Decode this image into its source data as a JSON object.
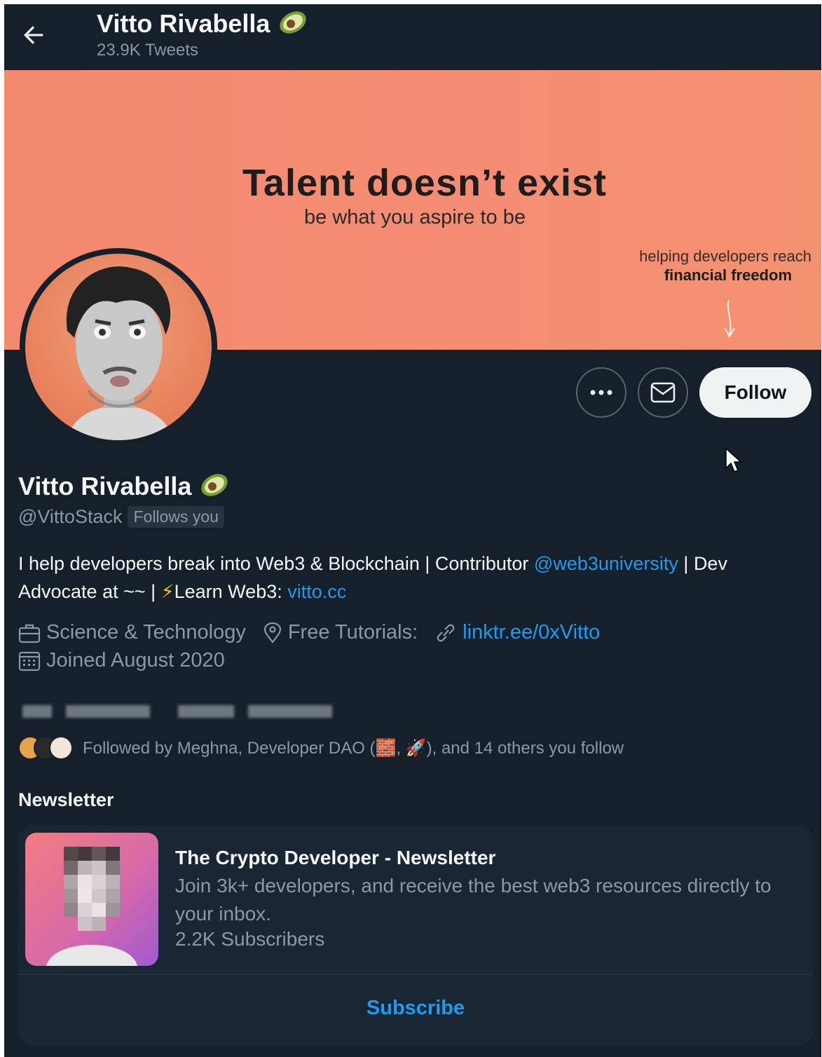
{
  "header": {
    "name": "Vitto Rivabella",
    "tweets": "23.9K Tweets"
  },
  "banner": {
    "title": "Talent doesn’t exist",
    "subtitle": "be what you aspire to be",
    "help_line1": "helping developers reach",
    "help_line2": "financial freedom"
  },
  "actions": {
    "follow_label": "Follow"
  },
  "profile": {
    "name": "Vitto Rivabella",
    "handle": "@VittoStack",
    "follows_you": "Follows you",
    "bio_part1": "I help developers break into Web3 & Blockchain | Contributor ",
    "bio_mention": "@web3university",
    "bio_part2": " | Dev Advocate at ~~ | ",
    "bio_bolt": "⚡",
    "bio_part3": "Learn Web3: ",
    "bio_link": "vitto.cc",
    "category": "Science & Technology",
    "location": "Free Tutorials:",
    "website": "linktr.ee/0xVitto",
    "joined": "Joined August 2020",
    "followed_by": "Followed by Meghna, Developer DAO (🧱, 🚀), and 14 others you follow"
  },
  "newsletter": {
    "heading": "Newsletter",
    "title": "The Crypto Developer - Newsletter",
    "description": "Join 3k+ developers, and receive the best web3 resources directly to your inbox.",
    "subscribers": "2.2K Subscribers",
    "subscribe_label": "Subscribe"
  },
  "colors": {
    "background": "#15202b",
    "accent": "#1d9bf0",
    "banner": "#f58d74"
  }
}
